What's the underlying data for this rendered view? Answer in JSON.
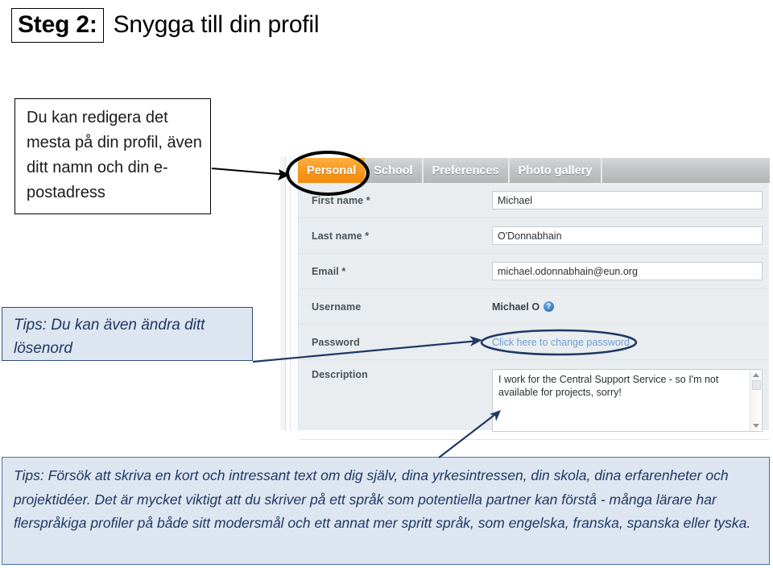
{
  "slide": {
    "step_badge": "Steg 2:",
    "title_rest": "Snygga till din profil"
  },
  "callouts": {
    "profile_edit": "Du kan redigera det mesta på din profil, även ditt namn och din e-postadress",
    "password_tip": "Tips: Du kan även ändra ditt lösenord",
    "description_tip": "Tips: Försök att skriva en kort och intressant text om dig själv, dina yrkesintressen, din skola, dina erfarenheter och projektidéer.  Det är mycket viktigt att du skriver på ett språk som potentiella partner kan förstå - många lärare har flerspråkiga profiler på både sitt modersmål och ett annat mer spritt språk, som engelska, franska, spanska eller tyska."
  },
  "app": {
    "tabs": [
      {
        "label": "Personal",
        "active": true
      },
      {
        "label": "School",
        "active": false
      },
      {
        "label": "Preferences",
        "active": false
      },
      {
        "label": "Photo gallery",
        "active": false
      }
    ],
    "form": {
      "first_name": {
        "label": "First name *",
        "value": "Michael"
      },
      "last_name": {
        "label": "Last name *",
        "value": "O'Donnabhain"
      },
      "email": {
        "label": "Email *",
        "value": "michael.odonnabhain@eun.org"
      },
      "username": {
        "label": "Username",
        "value": "Michael O",
        "help_icon": "help-question-icon"
      },
      "password": {
        "label": "Password",
        "link_text": "Click here to change password"
      },
      "description": {
        "label": "Description",
        "value": "I work for the Central Support Service - so I'm not available for projects, sorry!"
      }
    }
  },
  "colors": {
    "tab_active": "#f79820",
    "tab_bar": "#c0c4c5",
    "form_background": "#e9edf0",
    "link": "#6e9fd0",
    "callout_blue_fill": "#dde5f0",
    "callout_blue_border": "#2d4f78",
    "callout_text": "#1f3864",
    "annotation_black": "#000000",
    "annotation_navy": "#1f3864"
  }
}
